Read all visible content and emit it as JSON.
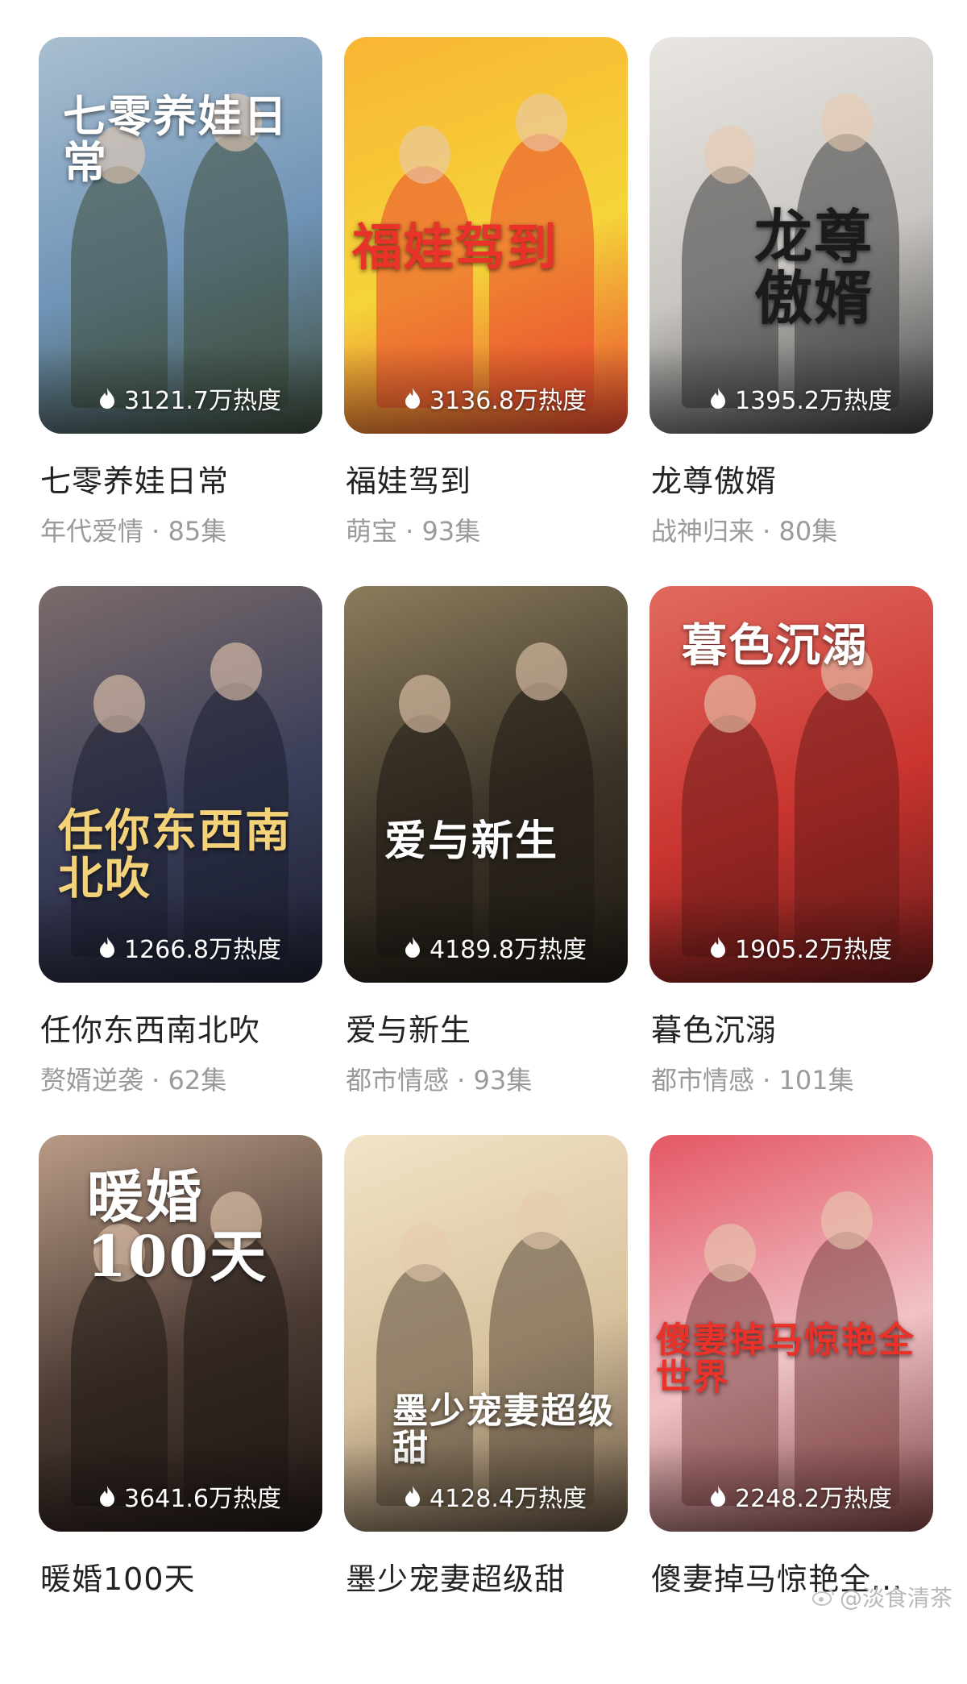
{
  "items": [
    {
      "title": "七零养娃日常",
      "genre": "年代爱情",
      "episodes": "85集",
      "heat": "3121.7万热度",
      "poster_text": "七零养娃日常",
      "colors": [
        "#6f93b6",
        "#a9bfd0",
        "#3c4a38"
      ]
    },
    {
      "title": "福娃驾到",
      "genre": "萌宝",
      "episodes": "93集",
      "heat": "3136.8万热度",
      "poster_text": "福娃驾到",
      "colors": [
        "#f5d43a",
        "#f9b533",
        "#e9452e"
      ]
    },
    {
      "title": "龙尊傲婿",
      "genre": "战神归来",
      "episodes": "80集",
      "heat": "1395.2万热度",
      "poster_text": "龙尊傲婿",
      "colors": [
        "#c9c6c2",
        "#e9e6e1",
        "#3b3b3b"
      ]
    },
    {
      "title": "任你东西南北吹",
      "genre": "赘婿逆袭",
      "episodes": "62集",
      "heat": "1266.8万热度",
      "poster_text": "任你东西南北吹",
      "colors": [
        "#3a3e5a",
        "#7b6b6a",
        "#1c1f30"
      ]
    },
    {
      "title": "爱与新生",
      "genre": "都市情感",
      "episodes": "93集",
      "heat": "4189.8万热度",
      "poster_text": "爱与新生",
      "colors": [
        "#3b3428",
        "#8b7c5c",
        "#1f1a14"
      ]
    },
    {
      "title": "暮色沉溺",
      "genre": "都市情感",
      "episodes": "101集",
      "heat": "1905.2万热度",
      "poster_text": "暮色沉溺",
      "colors": [
        "#c9342f",
        "#e06a5f",
        "#6b1b1a"
      ]
    },
    {
      "title": "暖婚100天",
      "genre": "",
      "episodes": "",
      "heat": "3641.6万热度",
      "poster_text": "暖婚100天",
      "colors": [
        "#4a3a33",
        "#b99b86",
        "#1f1714"
      ]
    },
    {
      "title": "墨少宠妻超级甜",
      "genre": "",
      "episodes": "",
      "heat": "4128.4万热度",
      "poster_text": "墨少宠妻超级甜",
      "colors": [
        "#d8c29e",
        "#f1e4c8",
        "#5a4a3a"
      ]
    },
    {
      "title": "傻妻掉马惊艳全...",
      "genre": "",
      "episodes": "",
      "heat": "2248.2万热度",
      "poster_text": "傻妻掉马惊艳全世界",
      "colors": [
        "#f0c2c6",
        "#e45765",
        "#7a4040"
      ]
    }
  ],
  "watermark": "@淡食清茶",
  "separator": " · "
}
